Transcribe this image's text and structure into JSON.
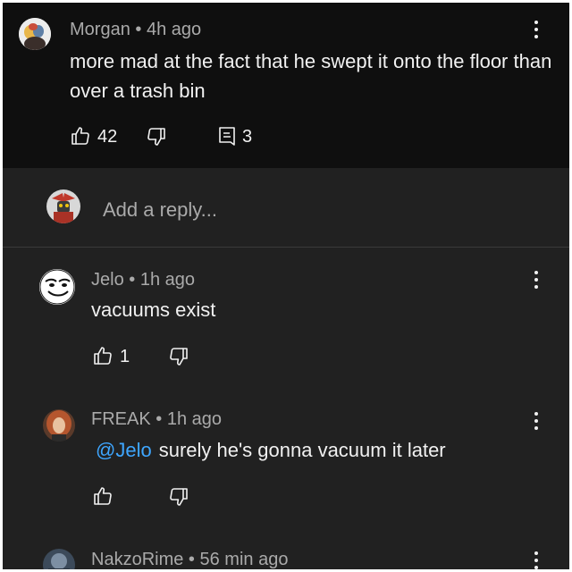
{
  "main_comment": {
    "author": "Morgan",
    "time": "4h ago",
    "text": "more mad at the fact that he swept it onto the floor than over a trash bin",
    "likes": "42",
    "replies": "3"
  },
  "reply_input": {
    "placeholder": "Add a reply..."
  },
  "replies": [
    {
      "author": "Jelo",
      "time": "1h ago",
      "text": "vacuums exist",
      "likes": "1"
    },
    {
      "author": "FREAK",
      "time": "1h ago",
      "mention": "@Jelo",
      "text": "surely he's gonna vacuum it later"
    },
    {
      "author": "NakzoRime",
      "time": "56 min ago"
    }
  ],
  "separator": "•",
  "icons": [
    "thumb-up-icon",
    "thumb-down-icon",
    "reply-comment-icon",
    "more-vert-icon"
  ],
  "colors": {
    "background": "#212121",
    "main_comment_background": "#0f0f0f",
    "text": "#f1f1f1",
    "meta": "#aaaaaa",
    "mention": "#3ea6ff"
  }
}
